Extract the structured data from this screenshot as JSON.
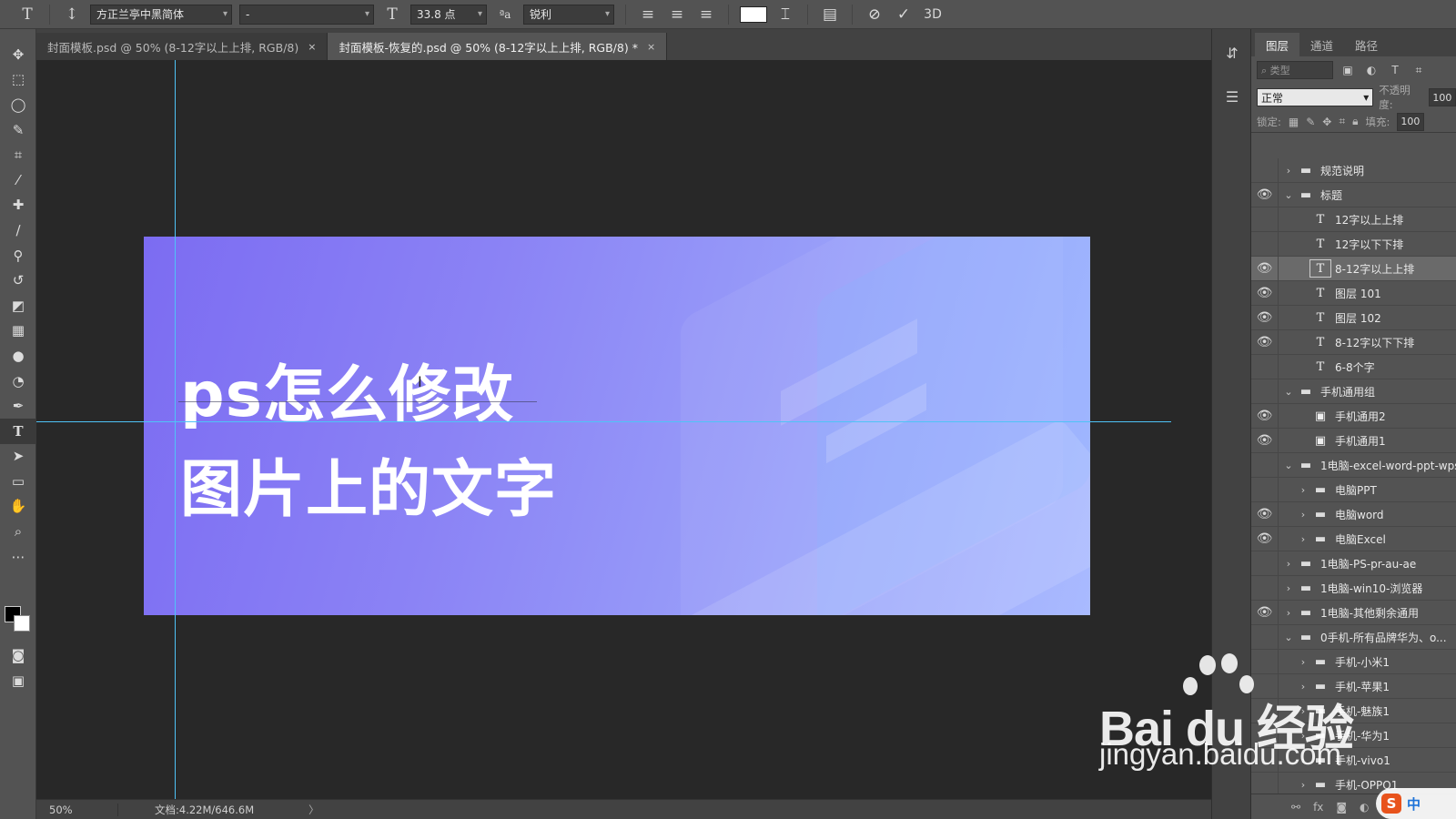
{
  "options_bar": {
    "font_family": "方正兰亭中黑简体",
    "font_style": "-",
    "font_size": "33.8 点",
    "anti_alias": "锐利",
    "text_color": "#ffffff",
    "mode_3d": "3D"
  },
  "tabs": [
    {
      "label": "封面模板.psd @ 50% (8-12字以上上排, RGB/8)",
      "close": "×"
    },
    {
      "label": "封面模板-恢复的.psd @ 50% (8-12字以上上排, RGB/8) *",
      "close": "×"
    }
  ],
  "canvas": {
    "headline_line1": "ps怎么修改",
    "headline_line2": "图片上的文字",
    "gradient_start": "#7c6cf2",
    "gradient_end": "#a9baff",
    "guide_color": "#4fc3f7"
  },
  "status_bar": {
    "zoom": "50%",
    "doc_info": "文档:4.22M/646.6M",
    "more": "〉"
  },
  "layers_panel": {
    "tabs": [
      "图层",
      "通道",
      "路径"
    ],
    "search_placeholder": "⌕ 类型",
    "blend_mode": "正常",
    "opacity_label": "不透明度:",
    "opacity_value": "100",
    "lock_label": "锁定:",
    "fill_label": "填充:",
    "fill_value": "100",
    "layers": [
      {
        "name": "规范说明",
        "type": "folder",
        "visible": false,
        "expanded": false,
        "indent": 0
      },
      {
        "name": "标题",
        "type": "folder",
        "visible": true,
        "expanded": true,
        "indent": 0
      },
      {
        "name": "12字以上上排",
        "type": "text",
        "visible": false,
        "indent": 1
      },
      {
        "name": "12字以下下排",
        "type": "text",
        "visible": false,
        "indent": 1
      },
      {
        "name": "8-12字以上上排",
        "type": "text",
        "visible": true,
        "indent": 1,
        "selected": true
      },
      {
        "name": "图层 101",
        "type": "text",
        "visible": true,
        "indent": 1
      },
      {
        "name": "图层 102",
        "type": "text",
        "visible": true,
        "indent": 1
      },
      {
        "name": "8-12字以下下排",
        "type": "text",
        "visible": true,
        "indent": 1
      },
      {
        "name": "6-8个字",
        "type": "text",
        "visible": false,
        "indent": 1
      },
      {
        "name": "手机通用组",
        "type": "folder",
        "visible": false,
        "expanded": true,
        "indent": 0
      },
      {
        "name": "手机通用2",
        "type": "smart",
        "visible": true,
        "indent": 1
      },
      {
        "name": "手机通用1",
        "type": "smart",
        "visible": true,
        "indent": 1
      },
      {
        "name": "1电脑-excel-word-ppt-wps",
        "type": "folder",
        "visible": false,
        "expanded": true,
        "indent": 0
      },
      {
        "name": "电脑PPT",
        "type": "folder",
        "visible": false,
        "expanded": false,
        "indent": 1
      },
      {
        "name": "电脑word",
        "type": "folder",
        "visible": true,
        "expanded": false,
        "indent": 1
      },
      {
        "name": "电脑Excel",
        "type": "folder",
        "visible": true,
        "expanded": false,
        "indent": 1
      },
      {
        "name": "1电脑-PS-pr-au-ae",
        "type": "folder",
        "visible": false,
        "expanded": false,
        "indent": 0
      },
      {
        "name": "1电脑-win10-浏览器",
        "type": "folder",
        "visible": false,
        "expanded": false,
        "indent": 0
      },
      {
        "name": "1电脑-其他剩余通用",
        "type": "folder",
        "visible": true,
        "expanded": false,
        "indent": 0
      },
      {
        "name": "0手机-所有品牌华为、o...",
        "type": "folder",
        "visible": false,
        "expanded": true,
        "indent": 0
      },
      {
        "name": "手机-小米1",
        "type": "folder",
        "visible": false,
        "expanded": false,
        "indent": 1
      },
      {
        "name": "手机-苹果1",
        "type": "folder",
        "visible": false,
        "expanded": false,
        "indent": 1
      },
      {
        "name": "手机-魅族1",
        "type": "folder",
        "visible": false,
        "expanded": false,
        "indent": 1
      },
      {
        "name": "手机-华为1",
        "type": "folder",
        "visible": false,
        "expanded": false,
        "indent": 1
      },
      {
        "name": "手机-vivo1",
        "type": "folder",
        "visible": false,
        "expanded": false,
        "indent": 1
      },
      {
        "name": "手机-OPPO1",
        "type": "folder",
        "visible": false,
        "expanded": false,
        "indent": 1
      }
    ],
    "footer_icons": [
      "link-icon",
      "fx-icon",
      "mask-icon",
      "adjustment-icon",
      "folder-icon"
    ]
  },
  "watermark": {
    "brand": "Bai du 经验",
    "url": "jingyan.baidu.com"
  },
  "ime": {
    "logo": "S",
    "mode": "中"
  }
}
